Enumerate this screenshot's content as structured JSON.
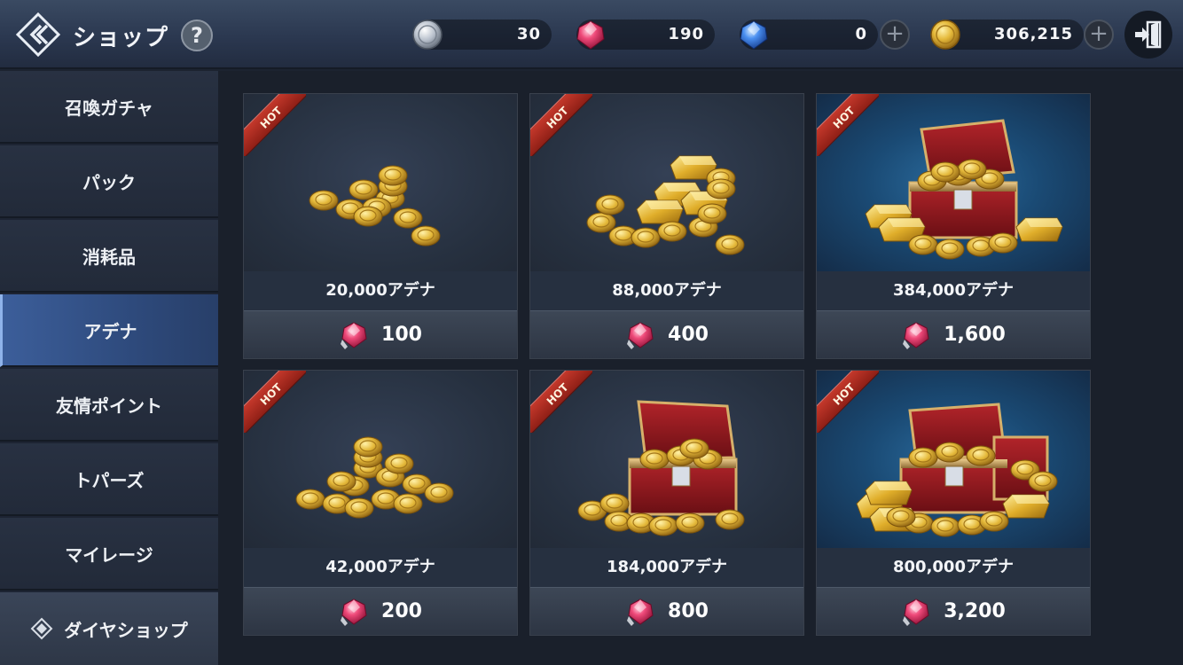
{
  "header": {
    "title": "ショップ",
    "help_label": "?",
    "currencies": [
      {
        "name": "silver-coin",
        "value": "30"
      },
      {
        "name": "red-diamond",
        "value": "190"
      },
      {
        "name": "blue-diamond",
        "value": "0"
      },
      {
        "name": "gold-adena",
        "value": "306,215"
      }
    ],
    "plus_label": "+"
  },
  "sidebar": {
    "items": [
      {
        "label": "召喚ガチャ"
      },
      {
        "label": "パック"
      },
      {
        "label": "消耗品"
      },
      {
        "label": "アデナ"
      },
      {
        "label": "友情ポイント"
      },
      {
        "label": "トパーズ"
      },
      {
        "label": "マイレージ"
      }
    ],
    "active_index": 3,
    "footer_label": "ダイヤショップ"
  },
  "products": [
    {
      "badge": "HOT",
      "amount": "20,000アデナ",
      "price": "100",
      "art": "coins-small"
    },
    {
      "badge": "HOT",
      "amount": "88,000アデナ",
      "price": "400",
      "art": "gold-bars"
    },
    {
      "badge": "HOT",
      "amount": "384,000アデナ",
      "price": "1,600",
      "art": "chest-blue"
    },
    {
      "badge": "HOT",
      "amount": "42,000アデナ",
      "price": "200",
      "art": "coins-pile"
    },
    {
      "badge": "HOT",
      "amount": "184,000アデナ",
      "price": "800",
      "art": "chest"
    },
    {
      "badge": "HOT",
      "amount": "800,000アデナ",
      "price": "3,200",
      "art": "chest-blue-big"
    }
  ],
  "colors": {
    "accent_active": "#3c5e9a",
    "hot_ribbon": "#c4382b",
    "gold": "#e2b73a",
    "red_gem": "#e8386a",
    "blue_gem": "#3a7fe0"
  }
}
